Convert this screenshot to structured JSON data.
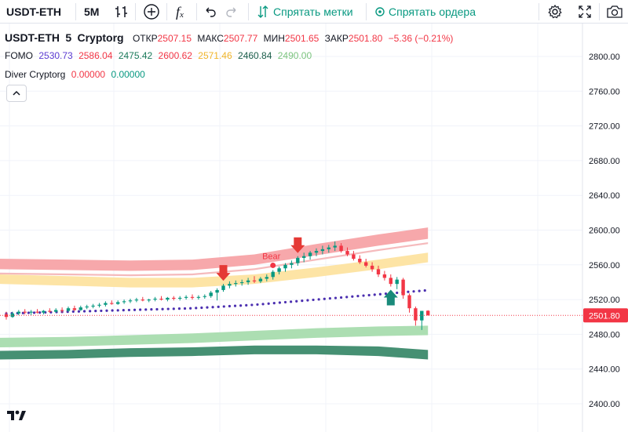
{
  "toolbar": {
    "symbol": "USDT-ETH",
    "interval": "5M",
    "hide_marks": "Спрятать метки",
    "hide_orders": "Спрятать ордера",
    "fx": "f"
  },
  "legend": {
    "symbol": "USDT-ETH",
    "interval": "5",
    "exchange": "Cryptorg",
    "open_label": "ОТКР",
    "open": "2507.15",
    "high_label": "МАКС",
    "high": "2507.77",
    "low_label": "МИН",
    "low": "2501.65",
    "close_label": "ЗАКР",
    "close": "2501.80",
    "change": "−5.36 (−0.21%)",
    "indicators": [
      {
        "name": "FOMO",
        "values": [
          {
            "v": "2530.73",
            "color": "#5b3bd1"
          },
          {
            "v": "2586.04",
            "color": "#f23645"
          },
          {
            "v": "2475.42",
            "color": "#1b7a5a"
          },
          {
            "v": "2600.62",
            "color": "#f23645"
          },
          {
            "v": "2571.46",
            "color": "#f0b429"
          },
          {
            "v": "2460.84",
            "color": "#1b5e4a"
          },
          {
            "v": "2490.00",
            "color": "#7cc47f"
          }
        ]
      },
      {
        "name": "Diver Cryptorg",
        "values": [
          {
            "v": "0.00000",
            "color": "#f23645"
          },
          {
            "v": "0.00000",
            "color": "#089981"
          }
        ]
      }
    ]
  },
  "colors": {
    "up": "#089981",
    "down": "#f23645",
    "fomo_dot": "#4b2fb0",
    "band_red": "#f7a3a6",
    "band_yellow": "#fde3a0",
    "band_green": "#a8dcae",
    "band_dark_green": "#3c8a6c"
  },
  "icons": [
    "bar-style-icon",
    "plus-circle-icon",
    "fx-icon",
    "undo-icon",
    "redo-icon",
    "marks-icon",
    "orders-icon",
    "settings-icon",
    "fullscreen-icon",
    "camera-icon",
    "chevron-up-icon",
    "tradingview-logo-icon"
  ],
  "chart_data": {
    "type": "line",
    "title": "USDT-ETH · 5 · Cryptorg",
    "y_ticks": [
      2800,
      2760,
      2720,
      2680,
      2640,
      2600,
      2560,
      2520,
      2480,
      2440,
      2400
    ],
    "y_tick_labels": [
      "2800.00",
      "2760.00",
      "2720.00",
      "2680.00",
      "2640.00",
      "2600.00",
      "2560.00",
      "2520.00",
      "2480.00",
      "2440.00",
      "2400.00"
    ],
    "ylim": [
      2390,
      2815
    ],
    "last_price": 2501.8,
    "last_price_label": "2501.80",
    "grid": true,
    "annotations": [
      {
        "text": "Bear",
        "color": "#f23645",
        "at_bar": 43
      },
      {
        "type": "down-arrow",
        "at_bar": 35
      },
      {
        "type": "down-arrow",
        "at_bar": 47
      },
      {
        "type": "up-arrow",
        "at_bar": 62
      }
    ],
    "bands": [
      {
        "name": "red upper",
        "color": "#f7a3a6",
        "x": [
          0,
          10,
          20,
          30,
          40,
          50,
          60,
          68
        ],
        "top": [
          2567,
          2566,
          2565,
          2566,
          2572,
          2584,
          2595,
          2603
        ],
        "bottom": [
          2555,
          2554,
          2553,
          2554,
          2560,
          2571,
          2582,
          2590
        ]
      },
      {
        "name": "pink line",
        "color": "#f4b6b8",
        "x": [
          0,
          10,
          20,
          30,
          40,
          50,
          60,
          68
        ],
        "top": [
          2551,
          2550,
          2549,
          2550,
          2556,
          2567,
          2578,
          2586
        ],
        "bottom": [
          2549,
          2548,
          2547,
          2548,
          2554,
          2565,
          2576,
          2584
        ]
      },
      {
        "name": "yellow",
        "color": "#fde3a0",
        "x": [
          0,
          10,
          20,
          30,
          40,
          50,
          60,
          68
        ],
        "top": [
          2549,
          2547,
          2545,
          2545,
          2549,
          2557,
          2566,
          2574
        ],
        "bottom": [
          2538,
          2536,
          2534,
          2534,
          2538,
          2546,
          2555,
          2563
        ]
      },
      {
        "name": "light green",
        "color": "#a8dcae",
        "x": [
          0,
          10,
          20,
          30,
          40,
          50,
          60,
          68
        ],
        "top": [
          2476,
          2477,
          2479,
          2481,
          2484,
          2487,
          2489,
          2490
        ],
        "bottom": [
          2465,
          2466,
          2468,
          2470,
          2473,
          2476,
          2478,
          2479
        ]
      },
      {
        "name": "dark green",
        "color": "#3c8a6c",
        "x": [
          0,
          10,
          20,
          30,
          40,
          50,
          60,
          68
        ],
        "top": [
          2461,
          2462,
          2464,
          2465,
          2467,
          2467,
          2466,
          2462
        ],
        "bottom": [
          2451,
          2452,
          2454,
          2455,
          2457,
          2457,
          2455,
          2451
        ]
      }
    ],
    "series": [
      {
        "name": "FOMO",
        "color": "#4b2fb0",
        "x": [
          0,
          5,
          10,
          15,
          20,
          25,
          30,
          35,
          40,
          45,
          50,
          55,
          60,
          65,
          68
        ],
        "values": [
          2504,
          2505,
          2506,
          2507,
          2508,
          2509,
          2510,
          2512,
          2514,
          2517,
          2520,
          2523,
          2526,
          2529,
          2530.73
        ]
      }
    ],
    "candles": [
      {
        "o": 2503,
        "h": 2506,
        "l": 2497,
        "c": 2500
      },
      {
        "o": 2500,
        "h": 2506,
        "l": 2499,
        "c": 2504
      },
      {
        "o": 2504,
        "h": 2508,
        "l": 2502,
        "c": 2506
      },
      {
        "o": 2506,
        "h": 2509,
        "l": 2503,
        "c": 2505
      },
      {
        "o": 2505,
        "h": 2508,
        "l": 2502,
        "c": 2506
      },
      {
        "o": 2506,
        "h": 2509,
        "l": 2504,
        "c": 2505
      },
      {
        "o": 2505,
        "h": 2508,
        "l": 2503,
        "c": 2507
      },
      {
        "o": 2507,
        "h": 2510,
        "l": 2505,
        "c": 2506
      },
      {
        "o": 2506,
        "h": 2510,
        "l": 2505,
        "c": 2508
      },
      {
        "o": 2508,
        "h": 2511,
        "l": 2505,
        "c": 2507
      },
      {
        "o": 2507,
        "h": 2512,
        "l": 2506,
        "c": 2510
      },
      {
        "o": 2510,
        "h": 2513,
        "l": 2507,
        "c": 2508
      },
      {
        "o": 2508,
        "h": 2513,
        "l": 2507,
        "c": 2511
      },
      {
        "o": 2511,
        "h": 2514,
        "l": 2509,
        "c": 2512
      },
      {
        "o": 2512,
        "h": 2515,
        "l": 2510,
        "c": 2513
      },
      {
        "o": 2513,
        "h": 2516,
        "l": 2511,
        "c": 2514
      },
      {
        "o": 2514,
        "h": 2518,
        "l": 2512,
        "c": 2516
      },
      {
        "o": 2516,
        "h": 2519,
        "l": 2514,
        "c": 2515
      },
      {
        "o": 2515,
        "h": 2519,
        "l": 2514,
        "c": 2517
      },
      {
        "o": 2517,
        "h": 2520,
        "l": 2515,
        "c": 2518
      },
      {
        "o": 2518,
        "h": 2521,
        "l": 2516,
        "c": 2519
      },
      {
        "o": 2519,
        "h": 2522,
        "l": 2517,
        "c": 2520
      },
      {
        "o": 2520,
        "h": 2523,
        "l": 2518,
        "c": 2519
      },
      {
        "o": 2519,
        "h": 2521,
        "l": 2517,
        "c": 2520
      },
      {
        "o": 2520,
        "h": 2523,
        "l": 2518,
        "c": 2521
      },
      {
        "o": 2521,
        "h": 2524,
        "l": 2519,
        "c": 2520
      },
      {
        "o": 2520,
        "h": 2523,
        "l": 2518,
        "c": 2522
      },
      {
        "o": 2522,
        "h": 2524,
        "l": 2519,
        "c": 2521
      },
      {
        "o": 2521,
        "h": 2524,
        "l": 2519,
        "c": 2522
      },
      {
        "o": 2522,
        "h": 2525,
        "l": 2520,
        "c": 2523
      },
      {
        "o": 2523,
        "h": 2526,
        "l": 2520,
        "c": 2522
      },
      {
        "o": 2522,
        "h": 2525,
        "l": 2520,
        "c": 2523
      },
      {
        "o": 2523,
        "h": 2526,
        "l": 2521,
        "c": 2524
      },
      {
        "o": 2524,
        "h": 2530,
        "l": 2522,
        "c": 2528
      },
      {
        "o": 2528,
        "h": 2533,
        "l": 2519,
        "c": 2531
      },
      {
        "o": 2531,
        "h": 2538,
        "l": 2529,
        "c": 2536
      },
      {
        "o": 2536,
        "h": 2541,
        "l": 2533,
        "c": 2538
      },
      {
        "o": 2538,
        "h": 2542,
        "l": 2535,
        "c": 2539
      },
      {
        "o": 2539,
        "h": 2543,
        "l": 2536,
        "c": 2540
      },
      {
        "o": 2540,
        "h": 2545,
        "l": 2537,
        "c": 2542
      },
      {
        "o": 2542,
        "h": 2547,
        "l": 2539,
        "c": 2541
      },
      {
        "o": 2541,
        "h": 2546,
        "l": 2539,
        "c": 2544
      },
      {
        "o": 2544,
        "h": 2549,
        "l": 2541,
        "c": 2546
      },
      {
        "o": 2546,
        "h": 2554,
        "l": 2543,
        "c": 2552
      },
      {
        "o": 2552,
        "h": 2558,
        "l": 2549,
        "c": 2556
      },
      {
        "o": 2556,
        "h": 2562,
        "l": 2552,
        "c": 2560
      },
      {
        "o": 2560,
        "h": 2565,
        "l": 2556,
        "c": 2562
      },
      {
        "o": 2562,
        "h": 2570,
        "l": 2559,
        "c": 2568
      },
      {
        "o": 2568,
        "h": 2574,
        "l": 2563,
        "c": 2570
      },
      {
        "o": 2570,
        "h": 2576,
        "l": 2566,
        "c": 2574
      },
      {
        "o": 2574,
        "h": 2579,
        "l": 2570,
        "c": 2576
      },
      {
        "o": 2576,
        "h": 2582,
        "l": 2572,
        "c": 2578
      },
      {
        "o": 2578,
        "h": 2583,
        "l": 2574,
        "c": 2580
      },
      {
        "o": 2580,
        "h": 2587,
        "l": 2576,
        "c": 2582
      },
      {
        "o": 2582,
        "h": 2585,
        "l": 2574,
        "c": 2576
      },
      {
        "o": 2576,
        "h": 2580,
        "l": 2570,
        "c": 2572
      },
      {
        "o": 2572,
        "h": 2576,
        "l": 2565,
        "c": 2567
      },
      {
        "o": 2567,
        "h": 2571,
        "l": 2561,
        "c": 2563
      },
      {
        "o": 2563,
        "h": 2567,
        "l": 2557,
        "c": 2559
      },
      {
        "o": 2559,
        "h": 2563,
        "l": 2552,
        "c": 2555
      },
      {
        "o": 2555,
        "h": 2559,
        "l": 2546,
        "c": 2549
      },
      {
        "o": 2549,
        "h": 2553,
        "l": 2542,
        "c": 2545
      },
      {
        "o": 2545,
        "h": 2549,
        "l": 2535,
        "c": 2538
      },
      {
        "o": 2538,
        "h": 2546,
        "l": 2532,
        "c": 2543
      },
      {
        "o": 2543,
        "h": 2545,
        "l": 2521,
        "c": 2525
      },
      {
        "o": 2525,
        "h": 2527,
        "l": 2505,
        "c": 2510
      },
      {
        "o": 2510,
        "h": 2512,
        "l": 2490,
        "c": 2496
      },
      {
        "o": 2496,
        "h": 2507,
        "l": 2485,
        "c": 2507
      },
      {
        "o": 2507.15,
        "h": 2507.77,
        "l": 2501.65,
        "c": 2501.8
      }
    ]
  }
}
